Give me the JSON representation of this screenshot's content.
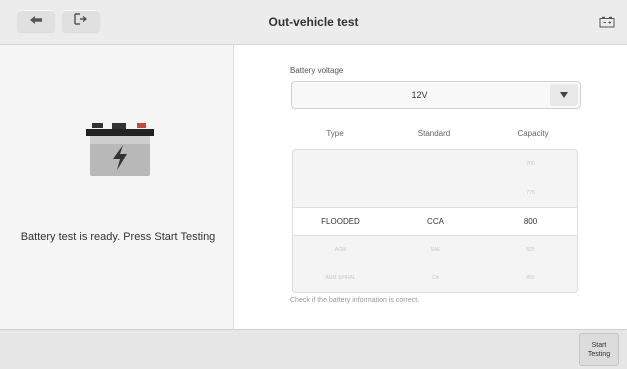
{
  "header": {
    "title": "Out-vehicle test",
    "back_icon": "back-arrow-icon",
    "exit_icon": "exit-icon",
    "status_icon": "battery-status-icon"
  },
  "left_panel": {
    "illustration_icon": "battery-lightning-icon",
    "ready_text": "Battery test is ready. Press Start Testing",
    "colors": {
      "terminal_pos": "#e53935",
      "body": "#b5b5b5",
      "lid": "#222222"
    }
  },
  "right_panel": {
    "voltage_label": "Battery voltage",
    "voltage_value": "12V",
    "dropdown_icon": "triangle-down-icon",
    "columns": [
      "Type",
      "Standard",
      "Capacity"
    ],
    "picker_rows": [
      [
        "",
        "",
        "700"
      ],
      [
        "",
        "",
        "775"
      ],
      [
        "FLOODED",
        "CCA",
        "800"
      ],
      [
        "AGM",
        "SAE",
        "825"
      ],
      [
        "AGM SPIRAL",
        "CA",
        "850"
      ]
    ],
    "selected_row": 2,
    "check_note": "Check if the battery information is correct."
  },
  "footer": {
    "start_button_label": "Start Testing"
  }
}
